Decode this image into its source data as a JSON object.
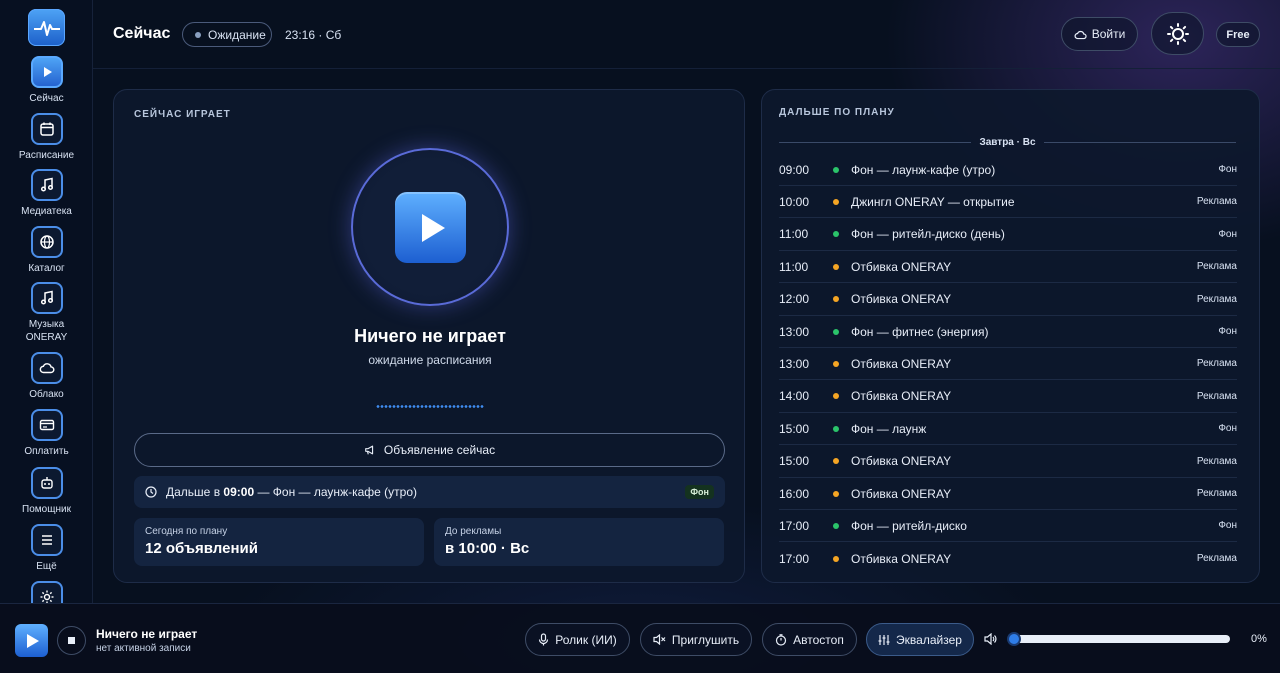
{
  "sidebar": {
    "items": [
      {
        "label": "Сейчас",
        "icon": "play-icon",
        "active": true
      },
      {
        "label": "Расписание",
        "icon": "calendar-icon"
      },
      {
        "label": "Медиатека",
        "icon": "music-note-icon"
      },
      {
        "label": "Каталог",
        "icon": "globe-icon"
      },
      {
        "label": "Музыка ONERAY",
        "icon": "music-note-icon"
      },
      {
        "label": "Облако",
        "icon": "cloud-icon"
      },
      {
        "label": "Оплатить",
        "icon": "credit-card-icon"
      },
      {
        "label": "Помощник",
        "icon": "robot-icon"
      },
      {
        "label": "Ещё",
        "icon": "menu-icon"
      },
      {
        "label": "",
        "icon": "gear-icon"
      }
    ]
  },
  "header": {
    "title": "Сейчас",
    "status": "Ожидание",
    "time": "23:16 · Сб",
    "login_label": "Войти",
    "plan": "Free"
  },
  "now_playing": {
    "heading": "СЕЙЧАС ИГРАЕТ",
    "title": "Ничего не играет",
    "subtitle": "ожидание расписания",
    "announce_label": "Объявление сейчас",
    "next_prefix": "Дальше в",
    "next_time": "09:00",
    "next_rest": "— Фон — лаунж-кафе (утро)",
    "next_tag": "Фон",
    "stats": [
      {
        "label": "Сегодня по плану",
        "value": "12 объявлений"
      },
      {
        "label": "До рекламы",
        "value": "в 10:00 · Вс"
      }
    ]
  },
  "plan": {
    "heading": "ДАЛЬШЕ ПО ПЛАНУ",
    "day": "Завтра · Вс",
    "rows": [
      {
        "time": "09:00",
        "title": "Фон — лаунж-кафе (утро)",
        "type": "Фон"
      },
      {
        "time": "10:00",
        "title": "Джингл ONERAY — открытие",
        "type": "Реклама"
      },
      {
        "time": "11:00",
        "title": "Фон — ритейл-диско (день)",
        "type": "Фон"
      },
      {
        "time": "11:00",
        "title": "Отбивка ONERAY",
        "type": "Реклама"
      },
      {
        "time": "12:00",
        "title": "Отбивка ONERAY",
        "type": "Реклама"
      },
      {
        "time": "13:00",
        "title": "Фон — фитнес (энергия)",
        "type": "Фон"
      },
      {
        "time": "13:00",
        "title": "Отбивка ONERAY",
        "type": "Реклама"
      },
      {
        "time": "14:00",
        "title": "Отбивка ONERAY",
        "type": "Реклама"
      },
      {
        "time": "15:00",
        "title": "Фон — лаунж",
        "type": "Фон"
      },
      {
        "time": "15:00",
        "title": "Отбивка ONERAY",
        "type": "Реклама"
      },
      {
        "time": "16:00",
        "title": "Отбивка ONERAY",
        "type": "Реклама"
      },
      {
        "time": "17:00",
        "title": "Фон — ритейл-диско",
        "type": "Фон"
      },
      {
        "time": "17:00",
        "title": "Отбивка ONERAY",
        "type": "Реклама"
      }
    ]
  },
  "player": {
    "title": "Ничего не играет",
    "subtitle": "нет активной записи",
    "buttons": {
      "clip": "Ролик (ИИ)",
      "mute": "Приглушить",
      "autostop": "Автостоп",
      "eq": "Эквалайзер"
    },
    "volume_percent": 0,
    "volume_label": "0%"
  },
  "colors": {
    "accent": "#3f8cf0",
    "bg": "#07101f",
    "dot_background": "#2bc46a",
    "dot_ad": "#f5a524"
  }
}
